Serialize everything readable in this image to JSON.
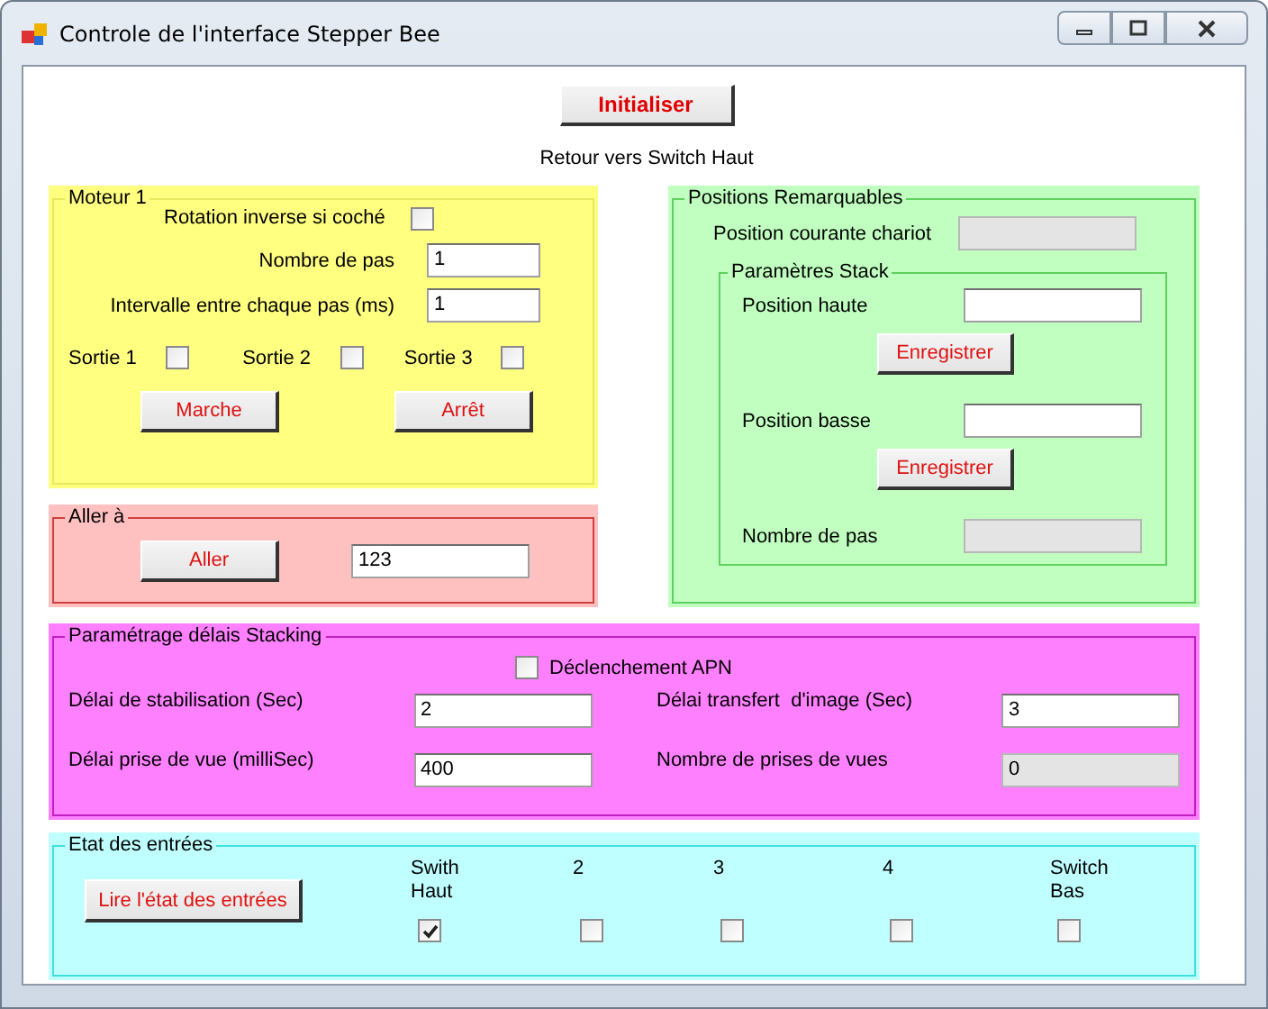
{
  "window": {
    "title": "Controle de l'interface Stepper Bee"
  },
  "init_button": "Initialiser",
  "status_text": "Retour vers Switch Haut",
  "motor": {
    "title": "Moteur 1",
    "reverse": {
      "label": "Rotation inverse si coché",
      "checked": false
    },
    "fields": [
      {
        "label": "Nombre de pas",
        "value": "1"
      },
      {
        "label": "Intervalle entre chaque pas (ms)",
        "value": "1"
      }
    ],
    "outputs": [
      {
        "label": "Sortie 1",
        "checked": false
      },
      {
        "label": "Sortie 2",
        "checked": false
      },
      {
        "label": "Sortie 3",
        "checked": false
      }
    ],
    "buttons": [
      "Marche",
      "Arrêt"
    ]
  },
  "goto": {
    "title": "Aller à",
    "button": "Aller",
    "value": "123"
  },
  "positions": {
    "title": "Positions Remarquables",
    "current": {
      "label": "Position courante chariot",
      "disabled": true
    },
    "stack": {
      "title": "Paramètres Stack",
      "rows": [
        {
          "label": "Position haute",
          "disabled": false,
          "button": "Enregistrer"
        },
        {
          "label": "Position basse",
          "disabled": false,
          "button": "Enregistrer"
        },
        {
          "label": "Nombre de pas",
          "disabled": true
        }
      ]
    }
  },
  "stacking": {
    "title": "Paramétrage délais Stacking",
    "trigger": {
      "label": "Déclenchement APN",
      "checked": false
    },
    "fields": [
      {
        "label": "Délai de stabilisation (Sec)",
        "value": "2",
        "disabled": false
      },
      {
        "label": "Délai transfert  d'image (Sec)",
        "value": "3",
        "disabled": false
      },
      {
        "label": "Délai prise de vue (milliSec)",
        "value": "400",
        "disabled": false
      },
      {
        "label": "Nombre de prises de vues",
        "value": "0",
        "disabled": true
      }
    ]
  },
  "inputs": {
    "title": "Etat des entrées",
    "button": "Lire l'état des entrées",
    "channels": [
      {
        "label": "Swith Haut",
        "checked": true
      },
      {
        "label": "2",
        "checked": false
      },
      {
        "label": "3",
        "checked": false
      },
      {
        "label": "4",
        "checked": false
      },
      {
        "label": "Switch Bas",
        "checked": false
      }
    ]
  }
}
